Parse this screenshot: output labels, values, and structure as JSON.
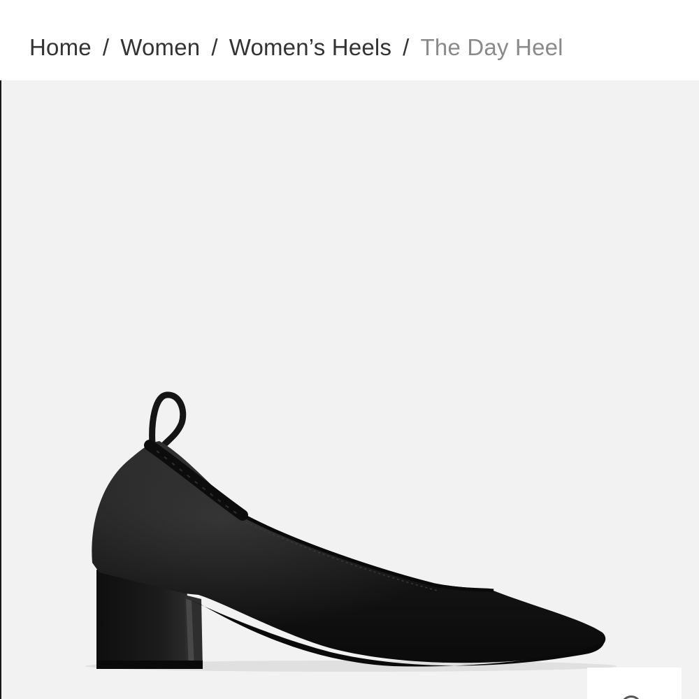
{
  "breadcrumb": {
    "items": [
      "Home",
      "Women",
      "Women’s Heels"
    ],
    "separator": "/",
    "current": "The Day Heel"
  },
  "product": {
    "image_icon": "black-leather-heel-image",
    "colors": {
      "stage_background": "#f2f2f2",
      "shoe": "#151515"
    }
  },
  "thumbnail": {
    "icon": "circle-icon"
  }
}
